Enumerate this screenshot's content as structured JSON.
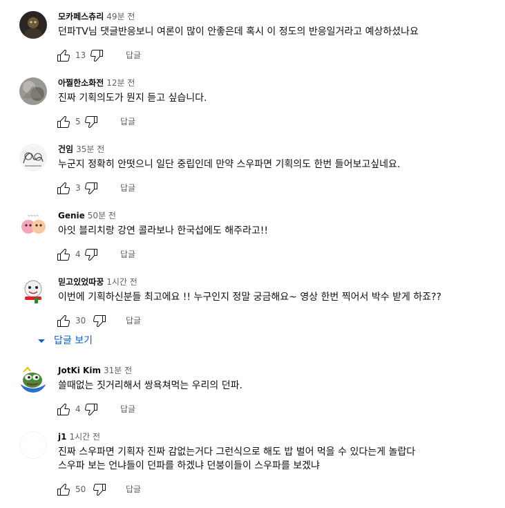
{
  "labels": {
    "reply": "답글",
    "view_replies": "답글 보기"
  },
  "comments": [
    {
      "author": "모카페스츄리",
      "time": "49분 전",
      "text": "던파TV님 댓글반응보니 여론이 많이 안좋은데 혹시 이 정도의 반응일거라고 예상하셨나요",
      "likes": "13",
      "avatar": "dark-avatar"
    },
    {
      "author": "아찔한소화전",
      "time": "12분 전",
      "text": "진짜 기획의도가 뭔지 듣고 싶습니다.",
      "likes": "5",
      "avatar": "grey-avatar"
    },
    {
      "author": "건임",
      "time": "35분 전",
      "text": "누군지 정확히 안떳으니 일단 중립인데 만약 스우파면 기획의도 한번 들어보고싶네요.",
      "likes": "3",
      "avatar": "sketch-avatar"
    },
    {
      "author": "Genie",
      "time": "50분 전",
      "text": "아잇 블리치랑 강연 콜라보나 한국섭에도 해주라고!!",
      "likes": "4",
      "avatar": "pink-characters-avatar"
    },
    {
      "author": "믿고있었따꿍",
      "time": "1시간 전",
      "text": "이번에 기획하신분들 최고에요 !! 누구인지 정말 궁금해요~ 영상 한번 찍어서 박수 받게 하죠??",
      "likes": "30",
      "avatar": "snowman-avatar"
    },
    {
      "author": "JotKi Kim",
      "time": "31분 전",
      "text": "쓸때없는 짓거리해서 쌍욕쳐먹는 우리의 던파.",
      "likes": "4",
      "avatar": "pepe-avatar"
    },
    {
      "author": "j1",
      "time": "1시간 전",
      "text_lines": [
        "진짜 스우파면 기획자 진짜 감없는거다 그런식으로 해도 밥 벌어 먹을 수 있다는게 놀랍다",
        "스우파 보는 언냐들이 던파를 하겠냐 던붕이들이 스우파를 보겠냐"
      ],
      "likes": "50",
      "avatar": "blank-avatar"
    }
  ],
  "colors": {
    "link_blue": "#065fd4",
    "secondary_text": "#606060",
    "primary_text": "#0f0f0f"
  },
  "icons": {
    "like": "thumb-up-icon",
    "dislike": "thumb-down-icon",
    "expand": "caret-down-icon"
  }
}
